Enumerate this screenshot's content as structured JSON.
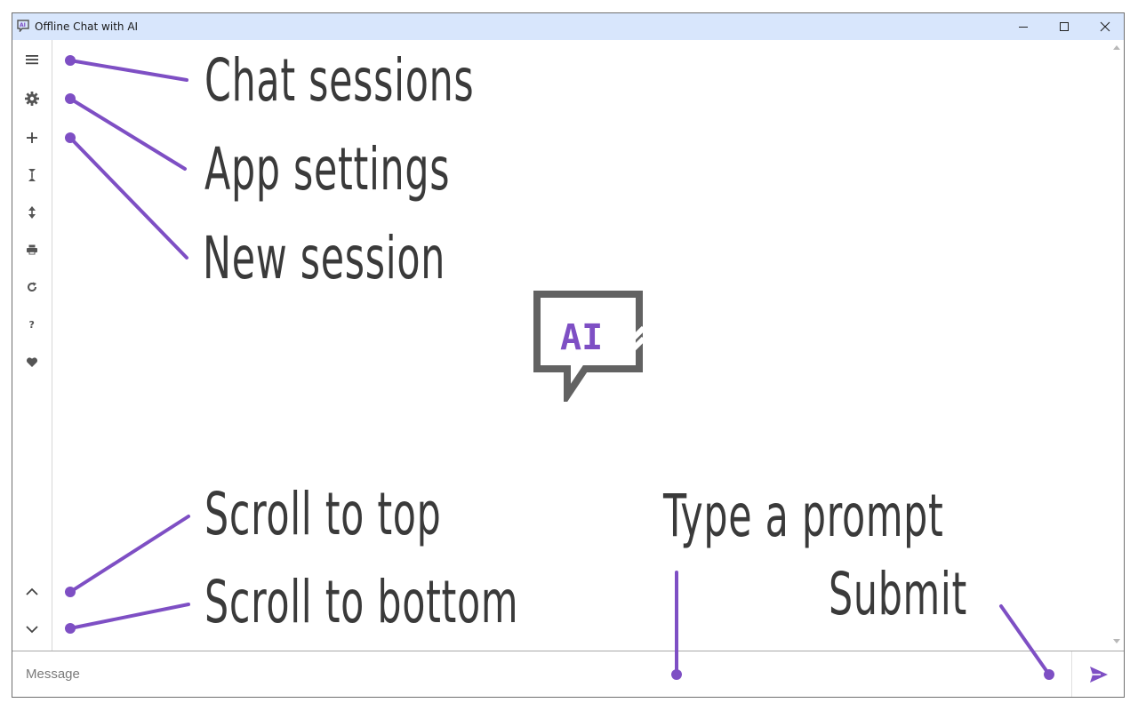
{
  "window": {
    "title": "Offline Chat with AI"
  },
  "sidebar": {
    "items": [
      {
        "icon": "menu-icon"
      },
      {
        "icon": "gear-icon"
      },
      {
        "icon": "plus-icon"
      },
      {
        "icon": "collapse-icon"
      },
      {
        "icon": "expand-icon"
      },
      {
        "icon": "printer-icon"
      },
      {
        "icon": "refresh-icon"
      },
      {
        "icon": "help-icon"
      },
      {
        "icon": "heart-icon"
      },
      {
        "icon": "chevron-up-icon"
      },
      {
        "icon": "chevron-down-icon"
      }
    ]
  },
  "logo": {
    "text": "AI"
  },
  "annotations": {
    "chat_sessions": "Chat sessions",
    "app_settings": "App settings",
    "new_session": "New session",
    "scroll_to_top": "Scroll to top",
    "scroll_to_bottom": "Scroll to bottom",
    "type_a_prompt": "Type a prompt",
    "submit": "Submit"
  },
  "input": {
    "placeholder": "Message",
    "value": ""
  },
  "colors": {
    "accent": "#7e4fc4",
    "titlebar": "#d8e6fc",
    "logo_gray": "#626262",
    "annotation_text": "#3a3a3a"
  }
}
